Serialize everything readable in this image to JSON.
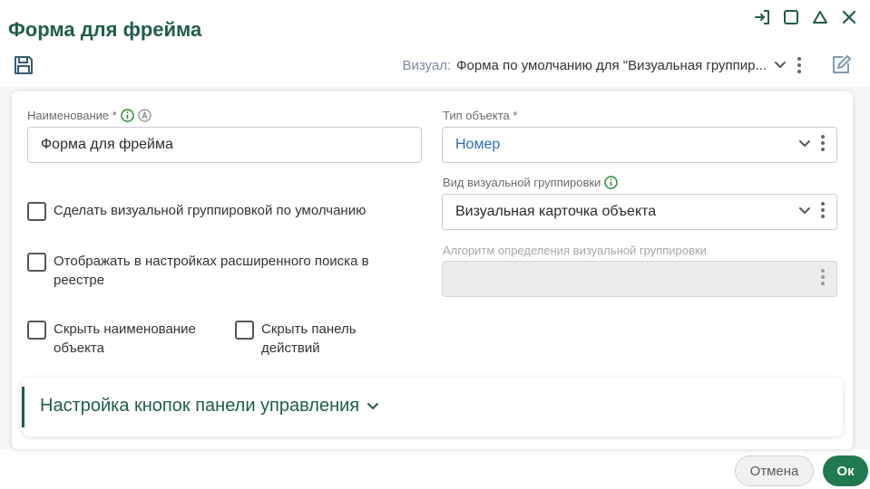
{
  "window": {
    "title": "Форма для фрейма",
    "controls": [
      "dock-icon",
      "maximize-icon",
      "collapse-icon",
      "close-icon"
    ]
  },
  "toolbar": {
    "save_icon": "save-icon",
    "visual_label": "Визуал:",
    "visual_value": "Форма по умолчанию для \"Визуальная группир...",
    "more_icon": "kebab-icon",
    "edit_icon": "edit-icon"
  },
  "form": {
    "name": {
      "label": "Наименование *",
      "value": "Форма для фрейма"
    },
    "object_type": {
      "label": "Тип объекта *",
      "value": "Номер"
    },
    "visual_group_kind": {
      "label": "Вид визуальной группировки",
      "value": "Визуальная карточка объекта"
    },
    "visual_group_algorithm": {
      "label": "Алгоритм определения визуальной группировки",
      "value": ""
    },
    "checkboxes": {
      "default_visual_group": "Сделать визуальной группировкой по умолчанию",
      "show_in_search_line1": "Отображать в настройках расширенного поиска в",
      "show_in_search_line2": "реестре",
      "hide_name_line1": "Скрыть наименование",
      "hide_name_line2": "объекта",
      "hide_panel_line1": "Скрыть панель",
      "hide_panel_line2": "действий"
    }
  },
  "accordion": {
    "title": "Настройка кнопок панели управления"
  },
  "footer": {
    "cancel": "Отмена",
    "ok": "Ок"
  },
  "colors": {
    "brand": "#1f5e45",
    "ok_button": "#1f7a4f",
    "info_green": "#2e8b3a",
    "link_blue": "#2a6eb0"
  }
}
